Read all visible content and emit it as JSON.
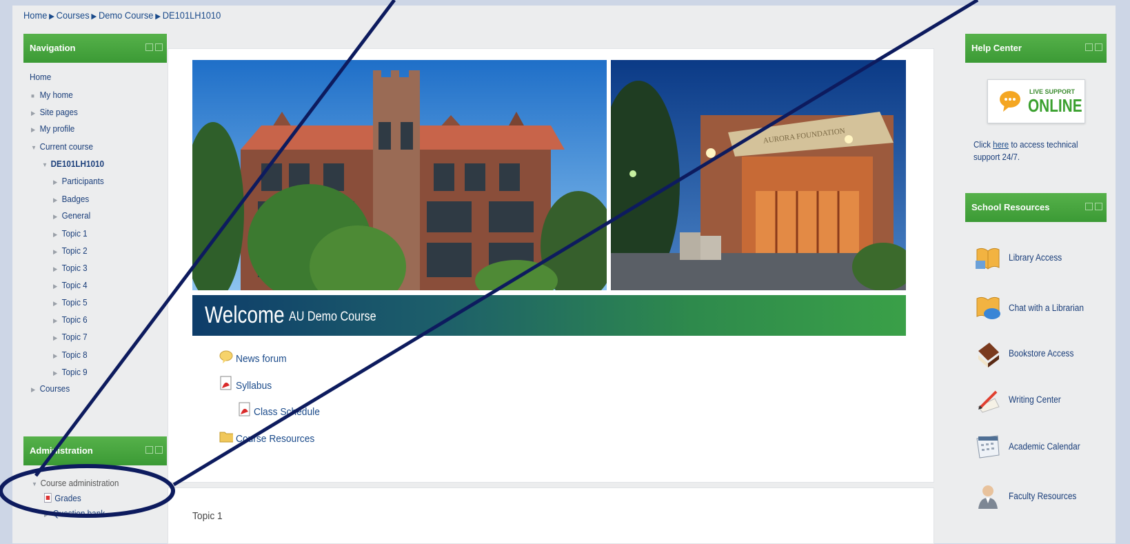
{
  "breadcrumb": {
    "items": [
      "Home",
      "Courses",
      "Demo Course",
      "DE101LH1010"
    ],
    "separator": "▶"
  },
  "navigation": {
    "title": "Navigation",
    "items": [
      {
        "label": "Home"
      },
      {
        "label": "My home"
      },
      {
        "label": "Site pages"
      },
      {
        "label": "My profile"
      },
      {
        "label": "Current course"
      },
      {
        "label": "DE101LH1010"
      },
      {
        "label": "Participants"
      },
      {
        "label": "Badges"
      },
      {
        "label": "General"
      },
      {
        "label": "Topic 1"
      },
      {
        "label": "Topic 2"
      },
      {
        "label": "Topic 3"
      },
      {
        "label": "Topic 4"
      },
      {
        "label": "Topic 5"
      },
      {
        "label": "Topic 6"
      },
      {
        "label": "Topic 7"
      },
      {
        "label": "Topic 8"
      },
      {
        "label": "Topic 9"
      },
      {
        "label": "Courses"
      }
    ]
  },
  "administration": {
    "title": "Administration",
    "items": [
      {
        "label": "Course administration"
      },
      {
        "label": "Grades"
      },
      {
        "label": "Question bank"
      }
    ]
  },
  "main": {
    "banner_sign": "AURORA FOUNDATION",
    "welcome": "Welcome",
    "course_name": "AU Demo Course",
    "activities": [
      {
        "label": "News forum",
        "icon": "forum-icon"
      },
      {
        "label": "Syllabus",
        "icon": "pdf-icon"
      },
      {
        "label": "Class Schedule",
        "icon": "pdf-icon"
      },
      {
        "label": "Course Resources",
        "icon": "folder-icon"
      }
    ],
    "topic1_title": "Topic 1"
  },
  "help_center": {
    "title": "Help Center",
    "live_small": "LIVE SUPPORT",
    "live_big": "ONLINE",
    "text_before": "Click ",
    "link": "here",
    "text_after": " to access technical support 24/7."
  },
  "school_resources": {
    "title": "School Resources",
    "items": [
      {
        "label": "Library Access",
        "icon": "book-icon"
      },
      {
        "label": "Chat with a Librarian",
        "icon": "chat-book-icon"
      },
      {
        "label": "Bookstore Access",
        "icon": "books-stack-icon"
      },
      {
        "label": "Writing Center",
        "icon": "pencil-paper-icon"
      },
      {
        "label": "Academic Calendar",
        "icon": "calendar-icon"
      },
      {
        "label": "Faculty Resources",
        "icon": "person-icon"
      }
    ]
  },
  "colors": {
    "block_header": "#45a43d",
    "annotation_line": "#0d1b5e",
    "link": "#1a4a8a"
  }
}
